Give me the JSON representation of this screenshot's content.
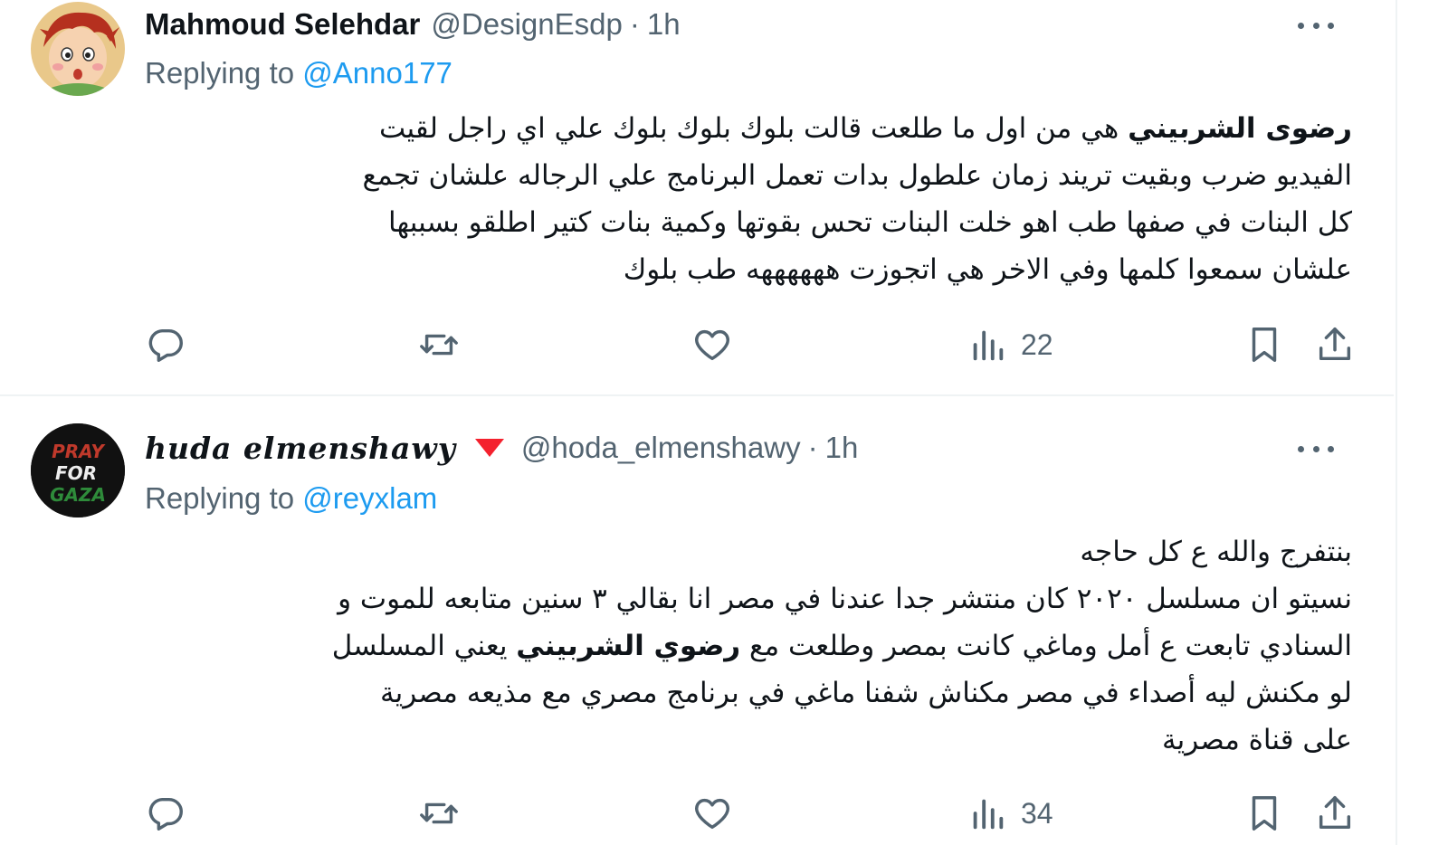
{
  "colors": {
    "accent": "#1d9bf0",
    "muted": "#536471",
    "text": "#0f1419",
    "divider": "#eff3f4",
    "badge": "#f4212e"
  },
  "tweets": [
    {
      "display_name": "Mahmoud Selehdar",
      "handle": "@DesignEsdp",
      "separator": "·",
      "time": "1h",
      "replying_prefix": "Replying to",
      "replying_to": "@Anno177",
      "body": {
        "line1_bold": "رضوى الشربيني",
        "line1_rest": " هي من اول ما طلعت قالت بلوك بلوك بلوك علي اي راجل لقيت",
        "line2": "الفيديو ضرب وبقيت تريند زمان علطول بدات تعمل البرنامج علي الرجاله علشان تجمع",
        "line3": "كل البنات في صفها طب اهو خلت البنات تحس بقوتها وكمية بنات كتير اطلقو بسببها",
        "line4": "علشان سمعوا كلمها وفي الاخر هي اتجوزت ههههههه طب بلوك"
      },
      "views": "22",
      "icons": [
        "avatar",
        "more-icon",
        "reply-icon",
        "retweet-icon",
        "like-icon",
        "views-icon",
        "bookmark-icon",
        "share-icon"
      ]
    },
    {
      "display_name": "huda elmenshawy",
      "badge_icon": "red-triangle-icon",
      "handle": "@hoda_elmenshawy",
      "separator": "·",
      "time": "1h",
      "replying_prefix": "Replying to",
      "replying_to": "@reyxlam",
      "avatar_text": [
        "PRAY",
        "FOR",
        "GAZA"
      ],
      "body": {
        "line1": "بنتفرج والله ع كل حاجه",
        "line2": "نسيتو ان مسلسل ٢٠٢٠ كان منتشر جدا عندنا في مصر انا بقالي ٣ سنين متابعه للموت و",
        "line3_pre": "السنادي تابعت ع أمل وماغي كانت بمصر وطلعت مع ",
        "line3_bold": "رضوي الشربيني",
        "line3_post": " يعني المسلسل",
        "line4": "لو مكنش ليه أصداء في مصر مكناش شفنا ماغي في برنامج مصري مع مذيعه مصرية",
        "line5": "على قناة مصرية"
      },
      "views": "34",
      "icons": [
        "avatar",
        "more-icon",
        "reply-icon",
        "retweet-icon",
        "like-icon",
        "views-icon",
        "bookmark-icon",
        "share-icon"
      ]
    }
  ]
}
